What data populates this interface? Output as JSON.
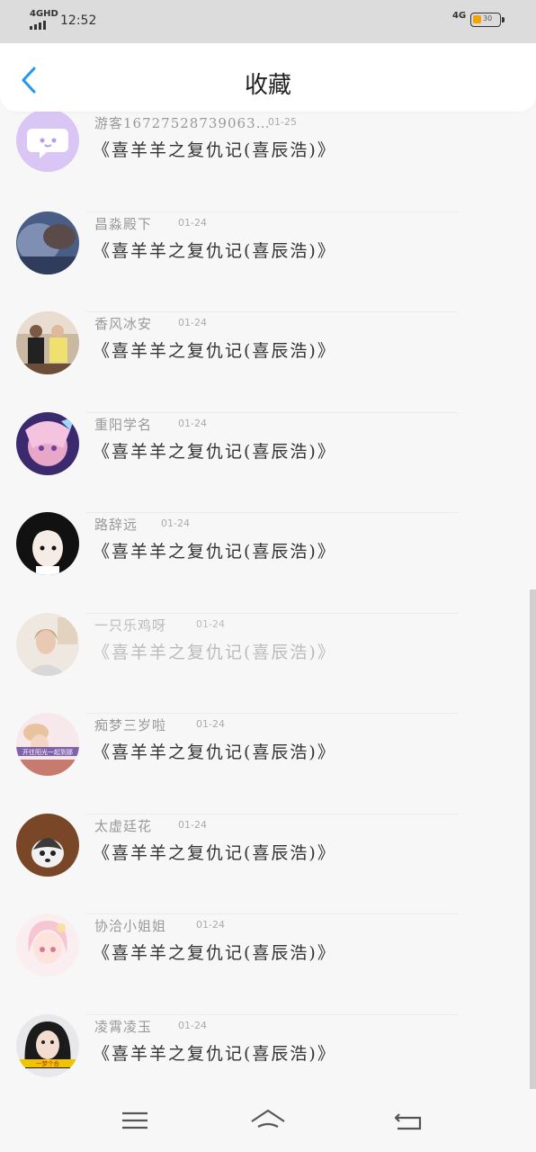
{
  "status_bar": {
    "network_left": "4GHD",
    "time": "12:52",
    "network_right": "4G",
    "battery_level": "30"
  },
  "header": {
    "title": "收藏"
  },
  "items": [
    {
      "name": "游客16727528739063…",
      "date": "01-25",
      "title": "《喜羊羊之复仇记(喜辰浩)》"
    },
    {
      "name": "昌淼殿下",
      "date": "01-24",
      "title": "《喜羊羊之复仇记(喜辰浩)》"
    },
    {
      "name": "香风冰安",
      "date": "01-24",
      "title": "《喜羊羊之复仇记(喜辰浩)》"
    },
    {
      "name": "重阳学名",
      "date": "01-24",
      "title": "《喜羊羊之复仇记(喜辰浩)》"
    },
    {
      "name": "路辞远",
      "date": "01-24",
      "title": "《喜羊羊之复仇记(喜辰浩)》"
    },
    {
      "name": "一只乐鸡呀",
      "date": "01-24",
      "title": "《喜羊羊之复仇记(喜辰浩)》"
    },
    {
      "name": "痴梦三岁啦",
      "date": "01-24",
      "title": "《喜羊羊之复仇记(喜辰浩)》",
      "avatar_caption": "开往阳光一起到那"
    },
    {
      "name": "太虚廷花",
      "date": "01-24",
      "title": "《喜羊羊之复仇记(喜辰浩)》"
    },
    {
      "name": "协洽小姐姐",
      "date": "01-24",
      "title": "《喜羊羊之复仇记(喜辰浩)》"
    },
    {
      "name": "凌霄凌玉",
      "date": "01-24",
      "title": "《喜羊羊之复仇记(喜辰浩)》",
      "avatar_caption": "一梦个合"
    }
  ],
  "colors": {
    "accent": "#2196f3",
    "title_text": "#333333",
    "meta_text": "#999999",
    "battery": "#f5a300"
  },
  "icons": {
    "back": "back-arrow-icon",
    "menu": "menu-icon",
    "home": "home-icon",
    "return": "return-icon"
  }
}
